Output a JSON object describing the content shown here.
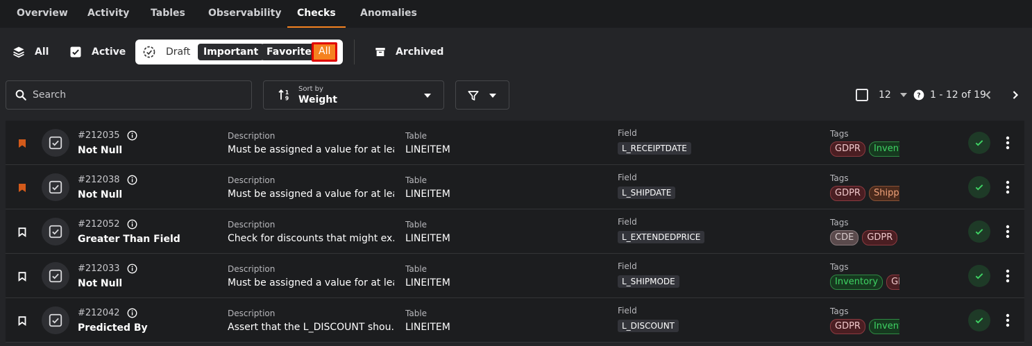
{
  "tabs": [
    {
      "label": "Overview",
      "active": false
    },
    {
      "label": "Activity",
      "active": false
    },
    {
      "label": "Tables",
      "active": false
    },
    {
      "label": "Observability",
      "active": false
    },
    {
      "label": "Checks",
      "active": true
    },
    {
      "label": "Anomalies",
      "active": false
    }
  ],
  "filters": {
    "all": "All",
    "active": "Active",
    "draft": "Draft",
    "important": "Important",
    "favorite": "Favorite",
    "status_all": "All",
    "archived": "Archived"
  },
  "toolbar": {
    "search_placeholder": "Search",
    "sort_label": "Sort by",
    "sort_value": "Weight",
    "page_size": "12",
    "page_range": "1 - 12 of 19"
  },
  "columns": {
    "description": "Description",
    "table": "Table",
    "field": "Field",
    "tags": "Tags"
  },
  "checks": [
    {
      "id": "#212035",
      "name": "Not Null",
      "description": "Must be assigned a value for at lea...",
      "table": "LINEITEM",
      "field": "L_RECEIPTDATE",
      "bookmarked": true,
      "tags": [
        "GDPR",
        "Inventory"
      ]
    },
    {
      "id": "#212038",
      "name": "Not Null",
      "description": "Must be assigned a value for at lea...",
      "table": "LINEITEM",
      "field": "L_SHIPDATE",
      "bookmarked": true,
      "tags": [
        "GDPR",
        "Shipping"
      ]
    },
    {
      "id": "#212052",
      "name": "Greater Than Field",
      "description": "Check for discounts that might ex...",
      "table": "LINEITEM",
      "field": "L_EXTENDEDPRICE",
      "bookmarked": false,
      "tags": [
        "CDE",
        "GDPR"
      ]
    },
    {
      "id": "#212033",
      "name": "Not Null",
      "description": "Must be assigned a value for at lea...",
      "table": "LINEITEM",
      "field": "L_SHIPMODE",
      "bookmarked": false,
      "tags": [
        "Inventory",
        "GDPR"
      ]
    },
    {
      "id": "#212042",
      "name": "Predicted By",
      "description": "Assert that the L_DISCOUNT shou...",
      "table": "LINEITEM",
      "field": "L_DISCOUNT",
      "bookmarked": false,
      "tags": [
        "GDPR",
        "Inventory"
      ]
    }
  ],
  "tag_colors": {
    "GDPR": {
      "bg": "#4a1e22",
      "border": "#8c3a40",
      "text": "#f0c8cb"
    },
    "Inventory": {
      "bg": "#16391f",
      "border": "#2f8a43",
      "text": "#3fd464"
    },
    "Shipping": {
      "bg": "#4a2a1c",
      "border": "#8a5236",
      "text": "#f0a27a"
    },
    "CDE": {
      "bg": "#5a4a4c",
      "border": "#8a7a7c",
      "text": "#d8cccd"
    }
  },
  "colors": {
    "accent": "#f58220",
    "bookmark_active": "#d35a1a",
    "success": "#3fd464"
  }
}
